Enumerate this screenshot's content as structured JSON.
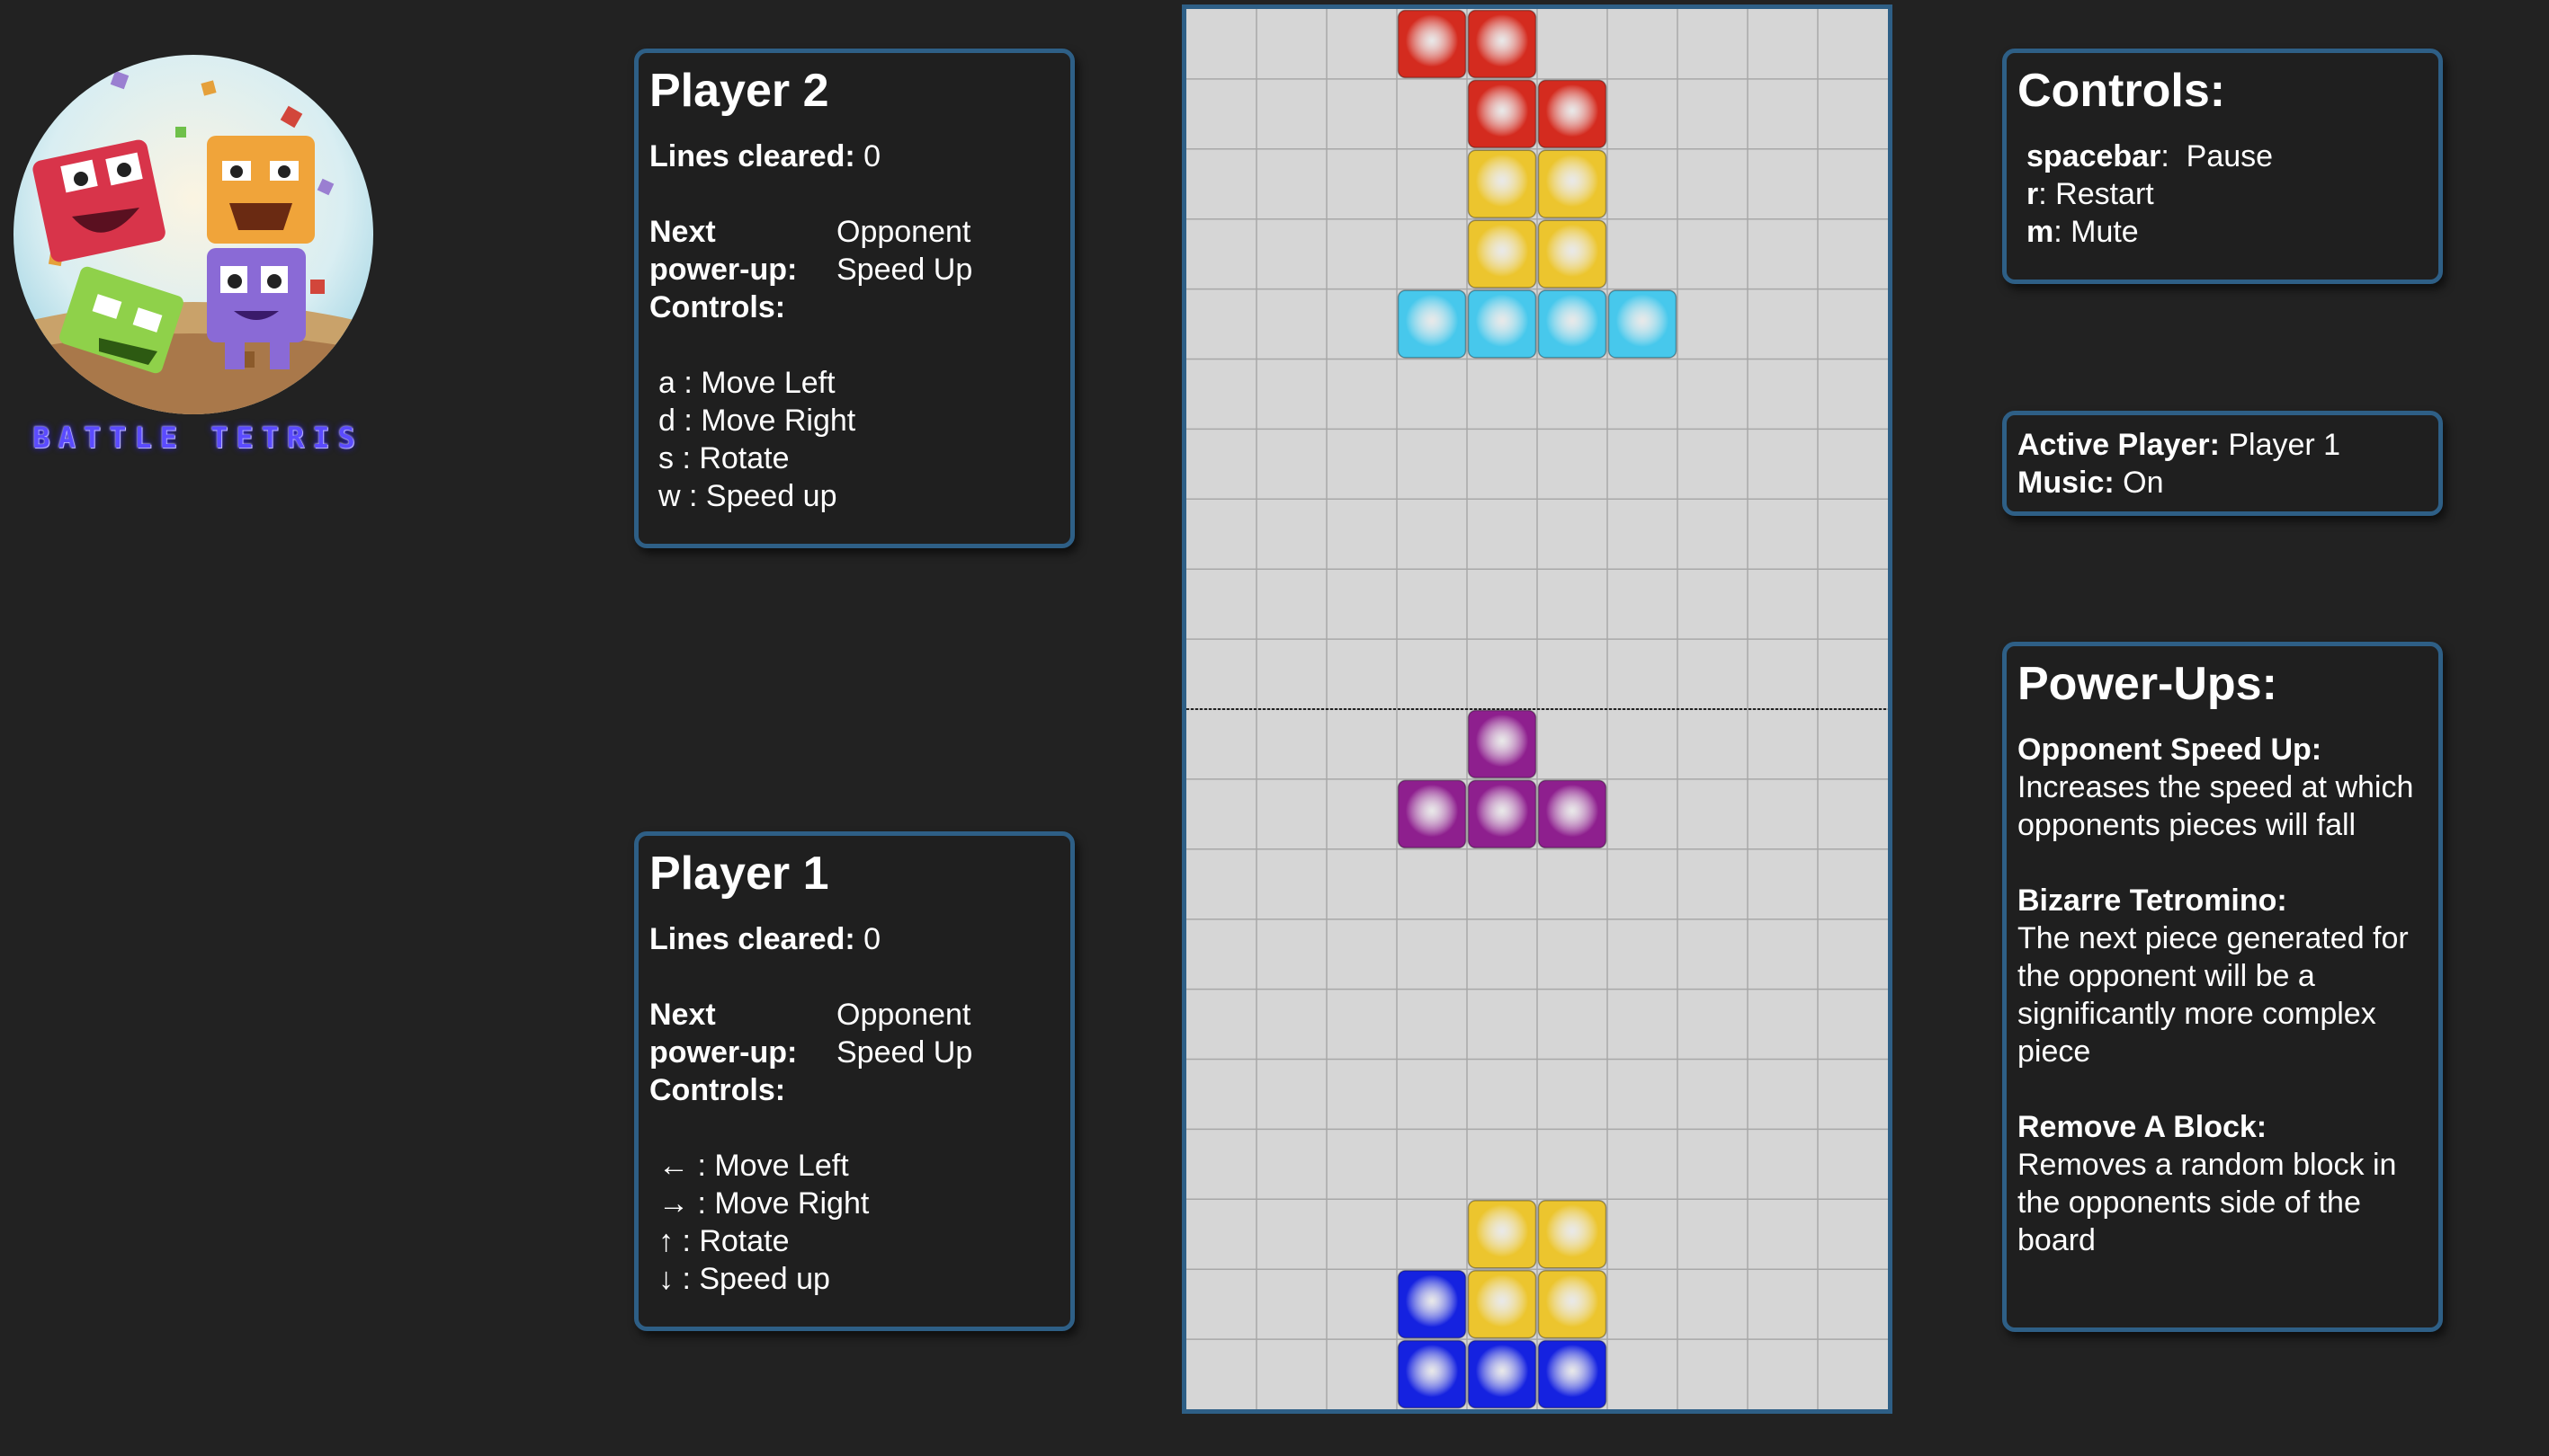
{
  "logo": {
    "title": "BATTLE TETRIS"
  },
  "player2": {
    "title": "Player 2",
    "lines_label": "Lines cleared:",
    "lines_value": "0",
    "next_label_1": "Next",
    "next_label_2": "power-up:",
    "next_value_1": "Opponent",
    "next_value_2": "Speed Up",
    "controls_label": "Controls:",
    "controls": [
      "a : Move Left",
      "d : Move Right",
      "s : Rotate",
      "w : Speed up"
    ]
  },
  "player1": {
    "title": "Player 1",
    "lines_label": "Lines cleared:",
    "lines_value": "0",
    "next_label_1": "Next",
    "next_label_2": "power-up:",
    "next_value_1": "Opponent",
    "next_value_2": "Speed Up",
    "controls_label": "Controls:",
    "controls": [
      "← : Move Left",
      "→ : Move Right",
      "↑ : Rotate",
      "↓ : Speed up"
    ]
  },
  "controls_panel": {
    "title": "Controls:",
    "items": [
      {
        "key": "spacebar",
        "action": "  Pause"
      },
      {
        "key": "r",
        "action": " Restart"
      },
      {
        "key": "m",
        "action": " Mute"
      }
    ]
  },
  "status": {
    "active_label": "Active Player:",
    "active_value": "Player 1",
    "music_label": "Music:",
    "music_value": "On"
  },
  "powerups": {
    "title": "Power-Ups:",
    "items": [
      {
        "name": "Opponent Speed Up:",
        "desc": "Increases the speed at which opponents pieces will fall"
      },
      {
        "name": "Bizarre Tetromino:",
        "desc": "The next piece generated for the opponent will be a significantly more complex piece"
      },
      {
        "name": "Remove A Block:",
        "desc": "Removes a random block in the opponents side of the board"
      }
    ]
  },
  "board": {
    "columns": 10,
    "rows": 20,
    "divider_after_row": 10,
    "colors": {
      "red": "#d42b1f",
      "yellow": "#ecc52e",
      "cyan": "#47c8ec",
      "purple": "#8e1f8e",
      "blue": "#1522e0",
      "grid_line": "#a8a8a8",
      "empty": "#d6d6d6",
      "border": "#2e5f86"
    },
    "blocks": [
      {
        "row": 0,
        "col": 3,
        "color": "red"
      },
      {
        "row": 0,
        "col": 4,
        "color": "red"
      },
      {
        "row": 1,
        "col": 4,
        "color": "red"
      },
      {
        "row": 1,
        "col": 5,
        "color": "red"
      },
      {
        "row": 2,
        "col": 4,
        "color": "yellow"
      },
      {
        "row": 2,
        "col": 5,
        "color": "yellow"
      },
      {
        "row": 3,
        "col": 4,
        "color": "yellow"
      },
      {
        "row": 3,
        "col": 5,
        "color": "yellow"
      },
      {
        "row": 4,
        "col": 3,
        "color": "cyan"
      },
      {
        "row": 4,
        "col": 4,
        "color": "cyan"
      },
      {
        "row": 4,
        "col": 5,
        "color": "cyan"
      },
      {
        "row": 4,
        "col": 6,
        "color": "cyan"
      },
      {
        "row": 10,
        "col": 4,
        "color": "purple"
      },
      {
        "row": 11,
        "col": 3,
        "color": "purple"
      },
      {
        "row": 11,
        "col": 4,
        "color": "purple"
      },
      {
        "row": 11,
        "col": 5,
        "color": "purple"
      },
      {
        "row": 17,
        "col": 4,
        "color": "yellow"
      },
      {
        "row": 17,
        "col": 5,
        "color": "yellow"
      },
      {
        "row": 18,
        "col": 3,
        "color": "blue"
      },
      {
        "row": 18,
        "col": 4,
        "color": "yellow"
      },
      {
        "row": 18,
        "col": 5,
        "color": "yellow"
      },
      {
        "row": 19,
        "col": 3,
        "color": "blue"
      },
      {
        "row": 19,
        "col": 4,
        "color": "blue"
      },
      {
        "row": 19,
        "col": 5,
        "color": "blue"
      }
    ]
  }
}
